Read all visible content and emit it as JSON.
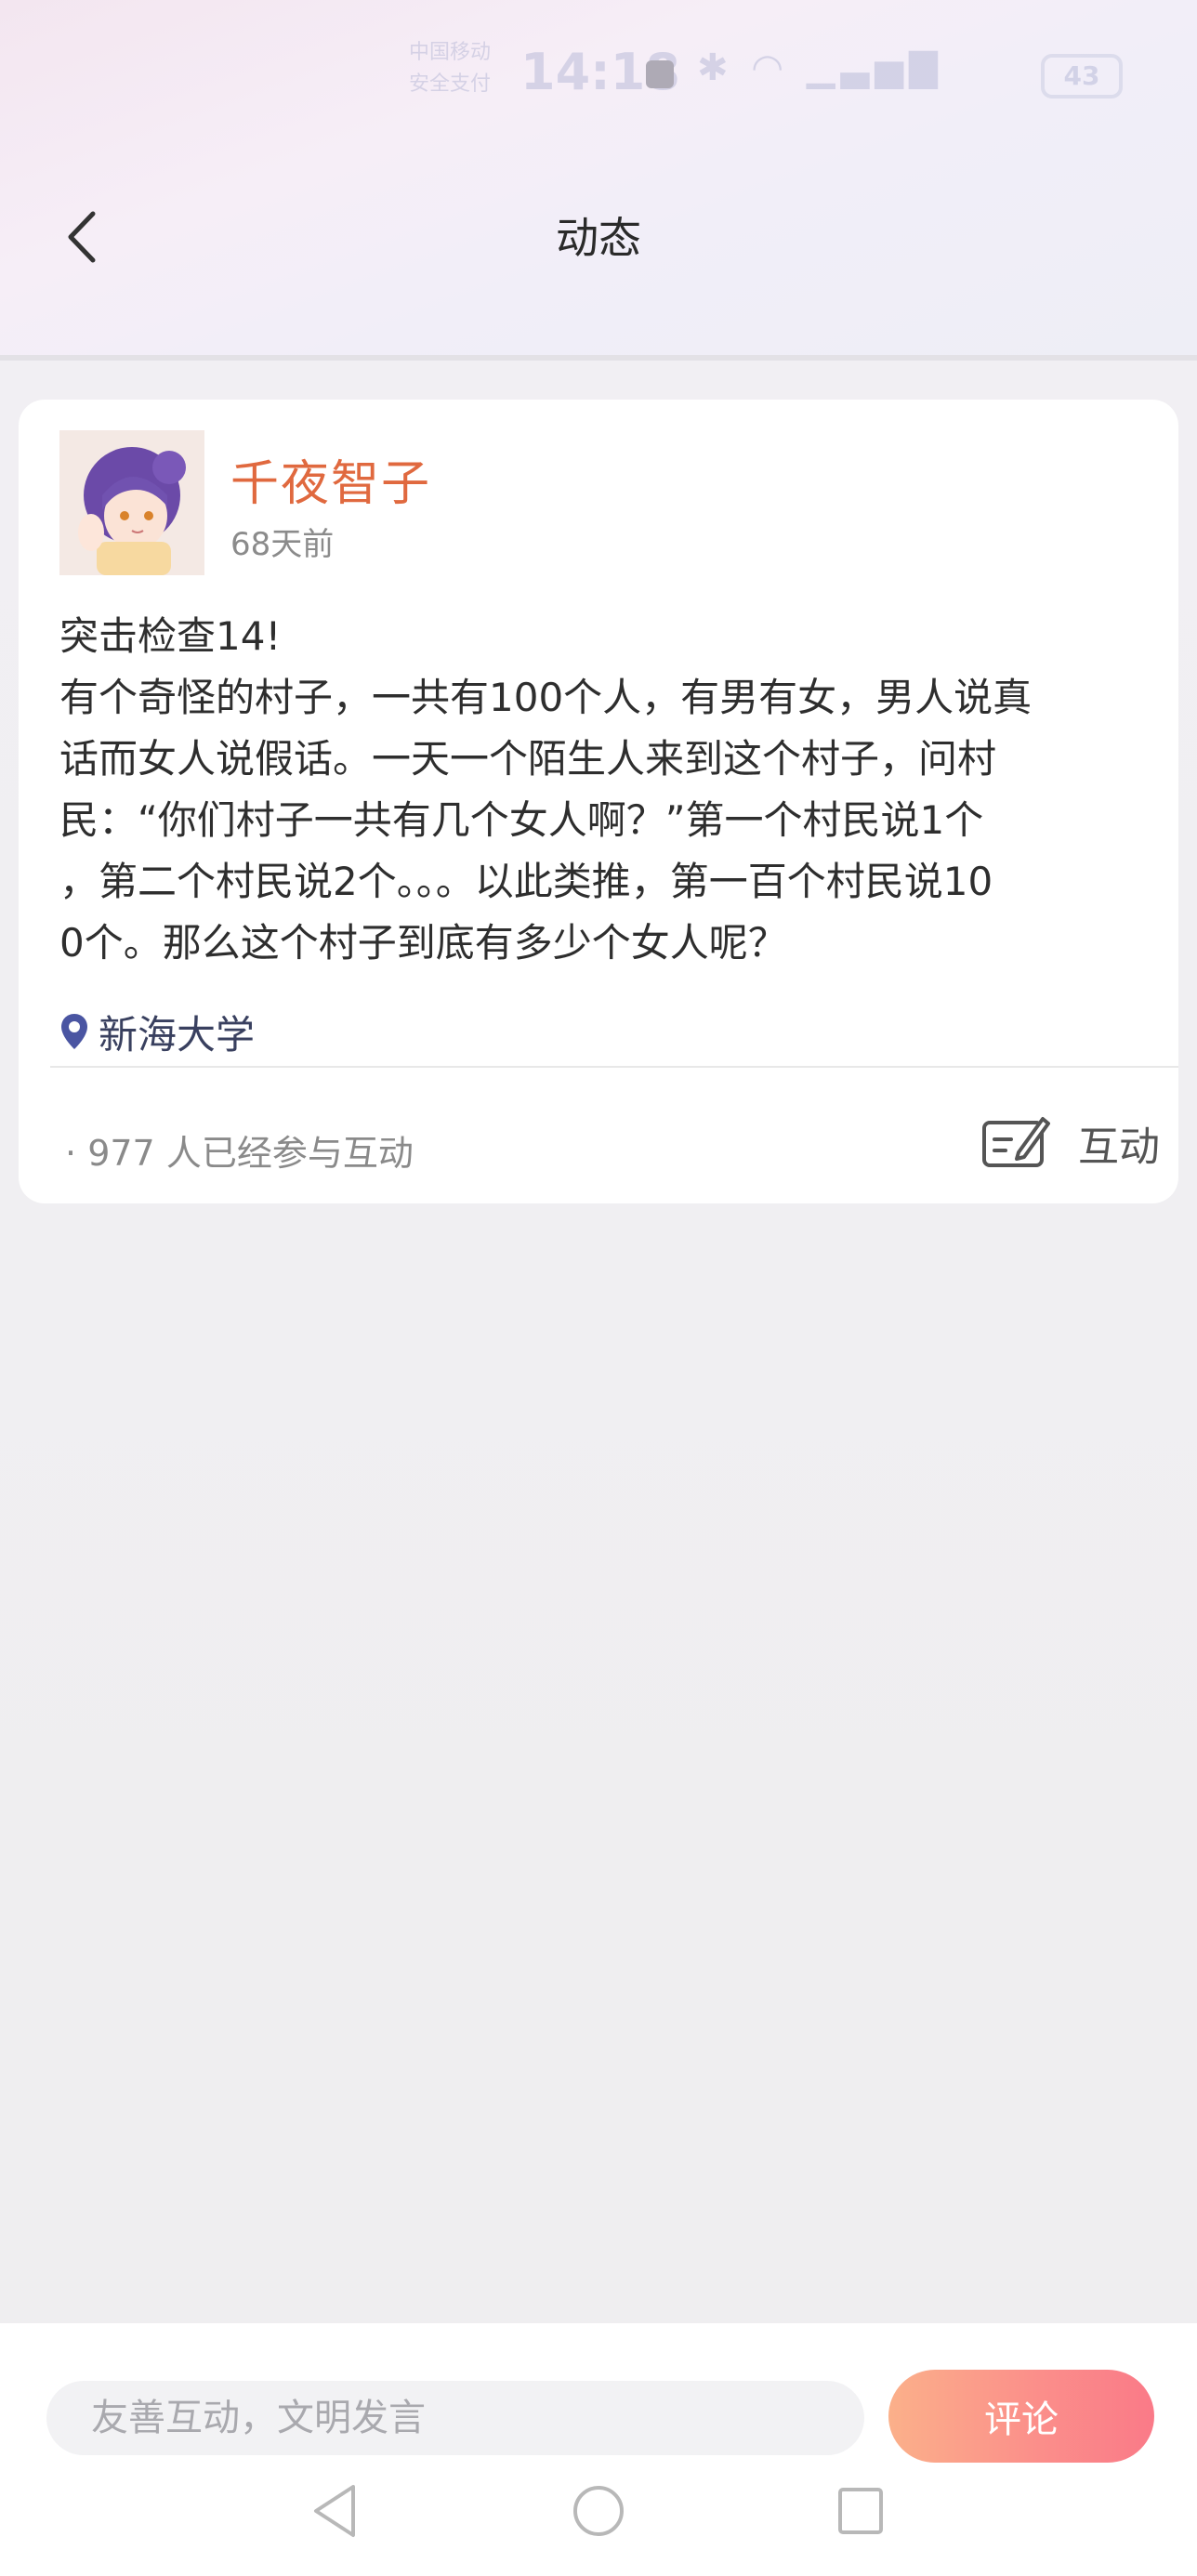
{
  "status_bar": {
    "carrier": "中国移动\n安全支付",
    "time": "14:18",
    "battery": "43"
  },
  "header": {
    "title": "动态"
  },
  "post": {
    "author": "千夜智子",
    "time_ago": "68天前",
    "title_line": "突击检查14!",
    "body_lines": [
      "有个奇怪的村子，一共有100个人，有男有女，男人说真",
      "话而女人说假话。一天一个陌生人来到这个村子，问村",
      "民：“你们村子一共有几个女人啊？”第一个村民说1个",
      "，第二个村民说2个。。。以此类推，第一百个村民说10",
      "0个。那么这个村子到底有多少个女人呢？"
    ],
    "location": "新海大学",
    "participants_prefix": "·",
    "participants_count": "977",
    "participants_suffix": "人已经参与互动",
    "interact_label": "互动"
  },
  "bottom_bar": {
    "comment_placeholder": "友善互动，文明发言",
    "comment_button": "评论"
  },
  "colors": {
    "author_name": "#e0693f",
    "location_pin": "#4a55a2",
    "comment_gradient_start": "#fbb08a",
    "comment_gradient_end": "#fa7a88"
  },
  "icons": {
    "back": "chevron-left-icon",
    "location": "map-pin-icon",
    "interact": "edit-note-icon",
    "nav_back": "triangle-back-icon",
    "nav_home": "circle-home-icon",
    "nav_recents": "square-recents-icon"
  }
}
